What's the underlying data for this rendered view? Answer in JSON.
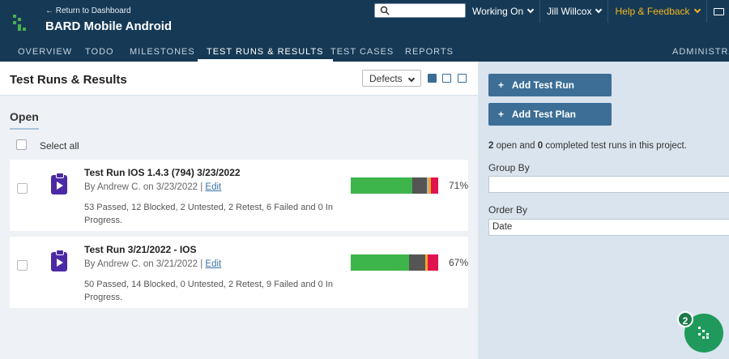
{
  "header": {
    "back_link": "← Return to Dashboard",
    "project_title": "BARD Mobile Android",
    "search_placeholder": "",
    "working_on": "Working On",
    "user": "Jill Willcox",
    "help": "Help & Feedback",
    "mail_icon": "mail-icon",
    "logo_icon": "testrail-logo-icon",
    "brand_color": "#163a56",
    "help_color": "#f5b51e"
  },
  "tabs": [
    {
      "label": "OVERVIEW",
      "active": false
    },
    {
      "label": "TODO",
      "active": false
    },
    {
      "label": "MILESTONES",
      "active": false
    },
    {
      "label": "TEST RUNS & RESULTS",
      "active": true
    },
    {
      "label": "TEST CASES",
      "active": false
    },
    {
      "label": "REPORTS",
      "active": false
    },
    {
      "label": "ADMINISTRAT",
      "active": false
    }
  ],
  "main": {
    "title": "Test Runs & Results",
    "defects_select": "Defects",
    "section_open": "Open",
    "select_all": "Select all",
    "runs": [
      {
        "title": "Test Run IOS 1.4.3 (794) 3/23/2022",
        "byline": "By Andrew C. on 3/23/2022",
        "edit": "Edit",
        "summary": "53 Passed, 12 Blocked, 2 Untested, 2 Retest, 6 Failed and 0 In Progress.",
        "percent": "71%",
        "counts": {
          "passed": 53,
          "blocked": 12,
          "untested": 2,
          "retest": 2,
          "failed": 6
        }
      },
      {
        "title": "Test Run 3/21/2022 - IOS",
        "byline": "By Andrew C. on 3/21/2022",
        "edit": "Edit",
        "summary": "50 Passed, 14 Blocked, 0 Untested, 2 Retest, 9 Failed and 0 In Progress.",
        "percent": "67%",
        "counts": {
          "passed": 50,
          "blocked": 14,
          "untested": 0,
          "retest": 2,
          "failed": 9
        }
      }
    ],
    "status_colors": {
      "passed": "#3db54a",
      "blocked": "#555555",
      "untested": "#b0b8c0",
      "retest": "#f5a623",
      "failed": "#e0134f"
    }
  },
  "sidebar": {
    "add_test_run": "Add Test Run",
    "add_test_plan": "Add Test Plan",
    "open_count": "2",
    "completed_count": "0",
    "status_text_1": "open and",
    "status_text_2": "completed test runs in this project.",
    "group_by_label": "Group By",
    "group_by_value": "",
    "order_by_label": "Order By",
    "order_by_value": "Date"
  },
  "chat": {
    "badge": "2"
  }
}
